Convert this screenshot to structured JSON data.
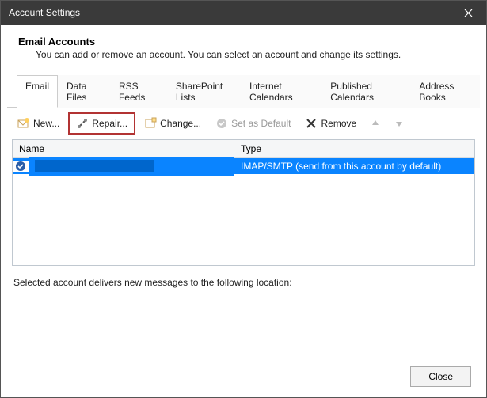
{
  "window": {
    "title": "Account Settings"
  },
  "header": {
    "title": "Email Accounts",
    "description": "You can add or remove an account. You can select an account and change its settings."
  },
  "tabs": [
    {
      "label": "Email",
      "active": true
    },
    {
      "label": "Data Files",
      "active": false
    },
    {
      "label": "RSS Feeds",
      "active": false
    },
    {
      "label": "SharePoint Lists",
      "active": false
    },
    {
      "label": "Internet Calendars",
      "active": false
    },
    {
      "label": "Published Calendars",
      "active": false
    },
    {
      "label": "Address Books",
      "active": false
    }
  ],
  "toolbar": {
    "new": "New...",
    "repair": "Repair...",
    "change": "Change...",
    "set_default": "Set as Default",
    "remove": "Remove"
  },
  "list": {
    "columns": {
      "name": "Name",
      "type": "Type"
    },
    "rows": [
      {
        "name": "",
        "type": "IMAP/SMTP (send from this account by default)"
      }
    ]
  },
  "location_text": "Selected account delivers new messages to the following location:",
  "footer": {
    "close": "Close"
  }
}
